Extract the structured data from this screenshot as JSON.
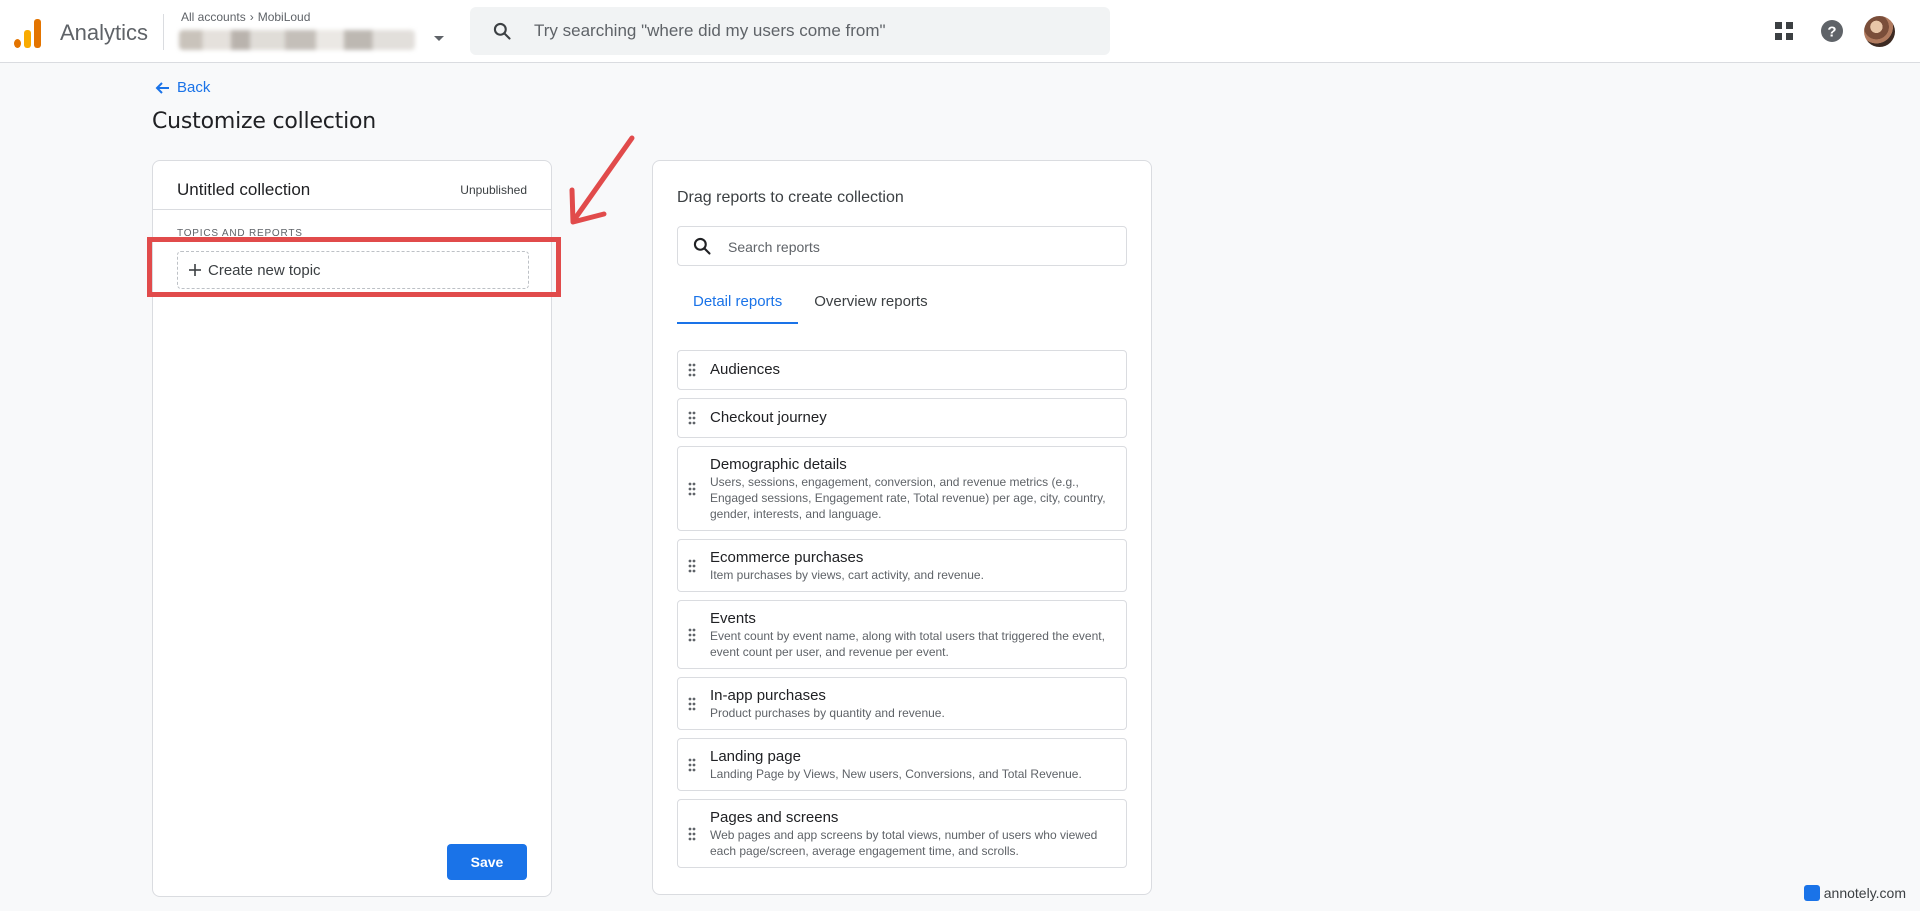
{
  "header": {
    "app_name": "Analytics",
    "account_crumb_root": "All accounts",
    "account_crumb_child": "MobiLoud",
    "search_placeholder": "Try searching \"where did my users come from\""
  },
  "page": {
    "back_label": "Back",
    "title": "Customize collection"
  },
  "collection": {
    "name": "Untitled collection",
    "status": "Unpublished",
    "section_label": "TOPICS AND REPORTS",
    "new_topic_label": "Create new topic",
    "save_label": "Save"
  },
  "library": {
    "title": "Drag reports to create collection",
    "search_placeholder": "Search reports",
    "tabs": [
      "Detail reports",
      "Overview reports"
    ],
    "active_tab": "Detail reports",
    "reports": [
      {
        "name": "Audiences",
        "desc": ""
      },
      {
        "name": "Checkout journey",
        "desc": ""
      },
      {
        "name": "Demographic details",
        "desc": "Users, sessions, engagement, conversion, and revenue metrics (e.g., Engaged sessions, Engagement rate, Total revenue) per age, city, country, gender, interests, and language."
      },
      {
        "name": "Ecommerce purchases",
        "desc": "Item purchases by views, cart activity, and revenue."
      },
      {
        "name": "Events",
        "desc": "Event count by event name, along with total users that triggered the event, event count per user, and revenue per event."
      },
      {
        "name": "In-app purchases",
        "desc": "Product purchases by quantity and revenue."
      },
      {
        "name": "Landing page",
        "desc": "Landing Page by Views, New users, Conversions, and Total Revenue."
      },
      {
        "name": "Pages and screens",
        "desc": "Web pages and app screens by total views, number of users who viewed each page/screen, average engagement time, and scrolls."
      }
    ]
  },
  "watermark": "annotely.com",
  "colors": {
    "accent": "#1a73e8",
    "annotation": "#e14b4b",
    "logo_orange": "#e37400",
    "logo_yellow": "#f9ab00"
  }
}
